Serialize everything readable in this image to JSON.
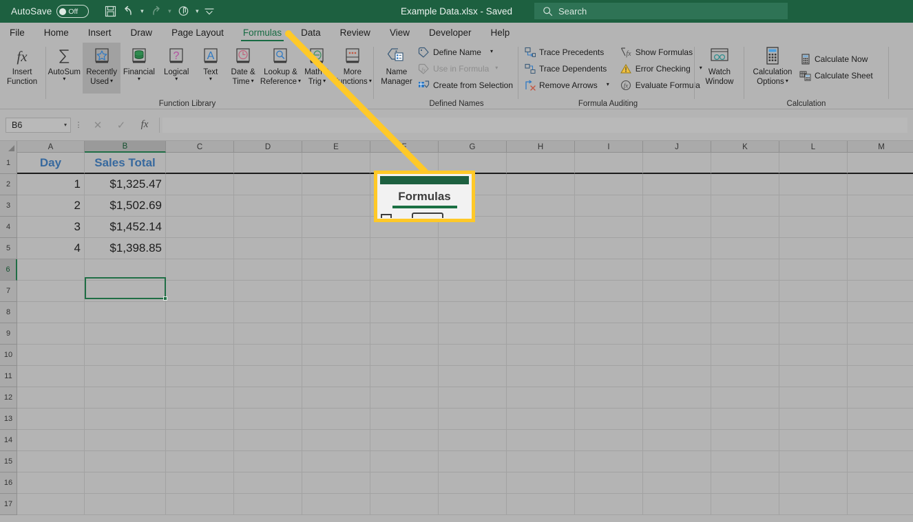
{
  "titlebar": {
    "autosave_label": "AutoSave",
    "autosave_state": "Off",
    "document_title": "Example Data.xlsx  -  Saved",
    "quick_access": [
      {
        "name": "save-icon",
        "label": "Save"
      },
      {
        "name": "undo-icon",
        "label": "Undo"
      },
      {
        "name": "redo-icon",
        "label": "Redo"
      },
      {
        "name": "touch-mode-icon",
        "label": "Touch/Mouse Mode"
      },
      {
        "name": "customize-qat-icon",
        "label": "Customize Quick Access Toolbar"
      }
    ],
    "search": {
      "placeholder": "Search",
      "icon": "search-icon"
    }
  },
  "tabs": [
    {
      "label": "File",
      "active": false
    },
    {
      "label": "Home",
      "active": false
    },
    {
      "label": "Insert",
      "active": false
    },
    {
      "label": "Draw",
      "active": false
    },
    {
      "label": "Page Layout",
      "active": false
    },
    {
      "label": "Formulas",
      "active": true
    },
    {
      "label": "Data",
      "active": false
    },
    {
      "label": "Review",
      "active": false
    },
    {
      "label": "View",
      "active": false
    },
    {
      "label": "Developer",
      "active": false
    },
    {
      "label": "Help",
      "active": false
    }
  ],
  "ribbon": {
    "groups": [
      {
        "title": "Function Library",
        "items": [
          {
            "line1": "Insert",
            "line2": "Function",
            "icon": "fx-icon",
            "caret": false,
            "selected": false
          },
          {
            "line1": "AutoSum",
            "line2": "",
            "icon": "sigma-icon",
            "caret": true,
            "selected": false
          },
          {
            "line1": "Recently",
            "line2": "Used",
            "icon": "star-book-icon",
            "caret": true,
            "selected": true
          },
          {
            "line1": "Financial",
            "line2": "",
            "icon": "coins-book-icon",
            "caret": true,
            "selected": false
          },
          {
            "line1": "Logical",
            "line2": "",
            "icon": "question-book-icon",
            "caret": true,
            "selected": false
          },
          {
            "line1": "Text",
            "line2": "",
            "icon": "letter-a-book-icon",
            "caret": true,
            "selected": false
          },
          {
            "line1": "Date &",
            "line2": "Time",
            "icon": "clock-book-icon",
            "caret": true,
            "selected": false
          },
          {
            "line1": "Lookup &",
            "line2": "Reference",
            "icon": "magnifier-book-icon",
            "caret": true,
            "selected": false
          },
          {
            "line1": "Math &",
            "line2": "Trig",
            "icon": "theta-book-icon",
            "caret": true,
            "selected": false
          },
          {
            "line1": "More",
            "line2": "Functions",
            "icon": "ellipsis-book-icon",
            "caret": true,
            "selected": false
          }
        ]
      },
      {
        "title": "Defined Names",
        "big": {
          "line1": "Name",
          "line2": "Manager",
          "icon": "name-manager-icon"
        },
        "items": [
          {
            "label": "Define Name",
            "icon": "tag-icon",
            "caret": true,
            "disabled": false
          },
          {
            "label": "Use in Formula",
            "icon": "tag-fx-icon",
            "caret": true,
            "disabled": true
          },
          {
            "label": "Create from Selection",
            "icon": "create-selection-icon",
            "caret": false,
            "disabled": false
          }
        ]
      },
      {
        "title": "Formula Auditing",
        "items": [
          {
            "label": "Trace Precedents",
            "icon": "trace-precedents-icon",
            "caret": false,
            "disabled": false
          },
          {
            "label": "Trace Dependents",
            "icon": "trace-dependents-icon",
            "caret": false,
            "disabled": false
          },
          {
            "label": "Remove Arrows",
            "icon": "remove-arrows-icon",
            "caret": true,
            "disabled": false
          },
          {
            "label": "Show Formulas",
            "icon": "show-formulas-icon",
            "caret": false,
            "disabled": false
          },
          {
            "label": "Error Checking",
            "icon": "error-checking-icon",
            "caret": true,
            "disabled": false
          },
          {
            "label": "Evaluate Formula",
            "icon": "evaluate-formula-icon",
            "caret": false,
            "disabled": false
          }
        ],
        "big": {
          "line1": "Watch",
          "line2": "Window",
          "icon": "watch-window-icon"
        }
      },
      {
        "title": "Calculation",
        "big": {
          "line1": "Calculation",
          "line2": "Options",
          "icon": "calculator-icon",
          "caret": true
        },
        "items": [
          {
            "label": "Calculate Now",
            "icon": "calculate-now-icon",
            "caret": false,
            "disabled": false
          },
          {
            "label": "Calculate Sheet",
            "icon": "calculate-sheet-icon",
            "caret": false,
            "disabled": false
          }
        ]
      }
    ]
  },
  "formula_bar": {
    "name_box_value": "B6",
    "cancel_icon": "cancel-icon",
    "enter_icon": "check-icon",
    "insert_function_icon": "fx-icon",
    "formula_value": "",
    "formula_placeholder": ""
  },
  "grid": {
    "columns": [
      "A",
      "B",
      "C",
      "D",
      "E",
      "F",
      "G",
      "H",
      "I",
      "J",
      "K",
      "L",
      "M"
    ],
    "selected_column": "B",
    "selected_row": 6,
    "selected_cell": "B6",
    "rows": [
      {
        "n": 1,
        "A": "Day",
        "B": "Sales Total",
        "header": true
      },
      {
        "n": 2,
        "A": "1",
        "B": "$1,325.47",
        "header": false
      },
      {
        "n": 3,
        "A": "2",
        "B": "$1,502.69",
        "header": false
      },
      {
        "n": 4,
        "A": "3",
        "B": "$1,452.14",
        "header": false
      },
      {
        "n": 5,
        "A": "4",
        "B": "$1,398.85",
        "header": false
      },
      {
        "n": 6,
        "A": "",
        "B": "",
        "header": false
      },
      {
        "n": 7,
        "A": "",
        "B": "",
        "header": false
      },
      {
        "n": 8,
        "A": "",
        "B": "",
        "header": false
      },
      {
        "n": 9,
        "A": "",
        "B": "",
        "header": false
      },
      {
        "n": 10,
        "A": "",
        "B": "",
        "header": false
      },
      {
        "n": 11,
        "A": "",
        "B": "",
        "header": false
      },
      {
        "n": 12,
        "A": "",
        "B": "",
        "header": false
      },
      {
        "n": 13,
        "A": "",
        "B": "",
        "header": false
      },
      {
        "n": 14,
        "A": "",
        "B": "",
        "header": false
      },
      {
        "n": 15,
        "A": "",
        "B": "",
        "header": false
      },
      {
        "n": 16,
        "A": "",
        "B": "",
        "header": false
      },
      {
        "n": 17,
        "A": "",
        "B": "",
        "header": false
      }
    ]
  },
  "annotation": {
    "callout_label": "Formulas",
    "arrow_color": "#ffc928",
    "callout_border_color": "#ffc928"
  },
  "colors": {
    "titlebar_green": "#1d6040",
    "ribbon_gray": "#b4b4b4",
    "accent_yellow": "#ffc928",
    "header_text_blue": "#37699e",
    "selection_green": "#1f6e45"
  }
}
